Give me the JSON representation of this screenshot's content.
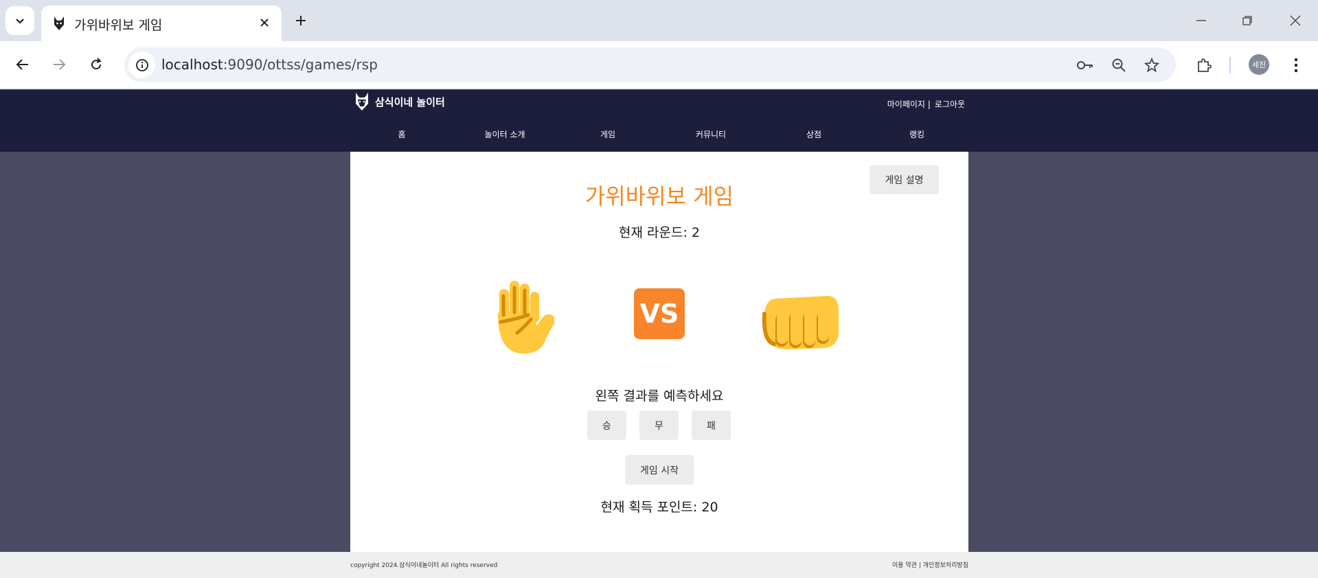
{
  "browser": {
    "tab_title": "가위바위보 게임",
    "url_host": "localhost",
    "url_path": ":9090/ottss/games/rsp",
    "profile_label": "세진"
  },
  "site": {
    "logo_text": "삼식이네 놀이터",
    "mypage": "마이페이지 |",
    "logout": "로그아웃",
    "menu": [
      "홈",
      "놀이터 소개",
      "게임",
      "커뮤니티",
      "상점",
      "랭킹"
    ]
  },
  "game": {
    "help_button": "게임 설명",
    "title": "가위바위보 게임",
    "round_text": "현재 라운드: 2",
    "left_hand": "paper-hand-icon",
    "vs_text": "VS",
    "right_hand": "fist-icon",
    "predict_text": "왼쪽 결과를 예측하세요",
    "choices": [
      "승",
      "무",
      "패"
    ],
    "start_button": "게임 시작",
    "points_text": "현재 획득 포인트: 20"
  },
  "footer": {
    "copyright": "copyright 2024.삼식이네놀이터 All rights reserved",
    "links": "이용 약관 | 개인정보처리방침"
  },
  "colors": {
    "accent": "#f7861e",
    "header_bg": "#1c1e3c",
    "page_bg": "#4a4b63",
    "hand_yellow": "#ffc83d",
    "hand_shadow": "#d48a0a"
  }
}
